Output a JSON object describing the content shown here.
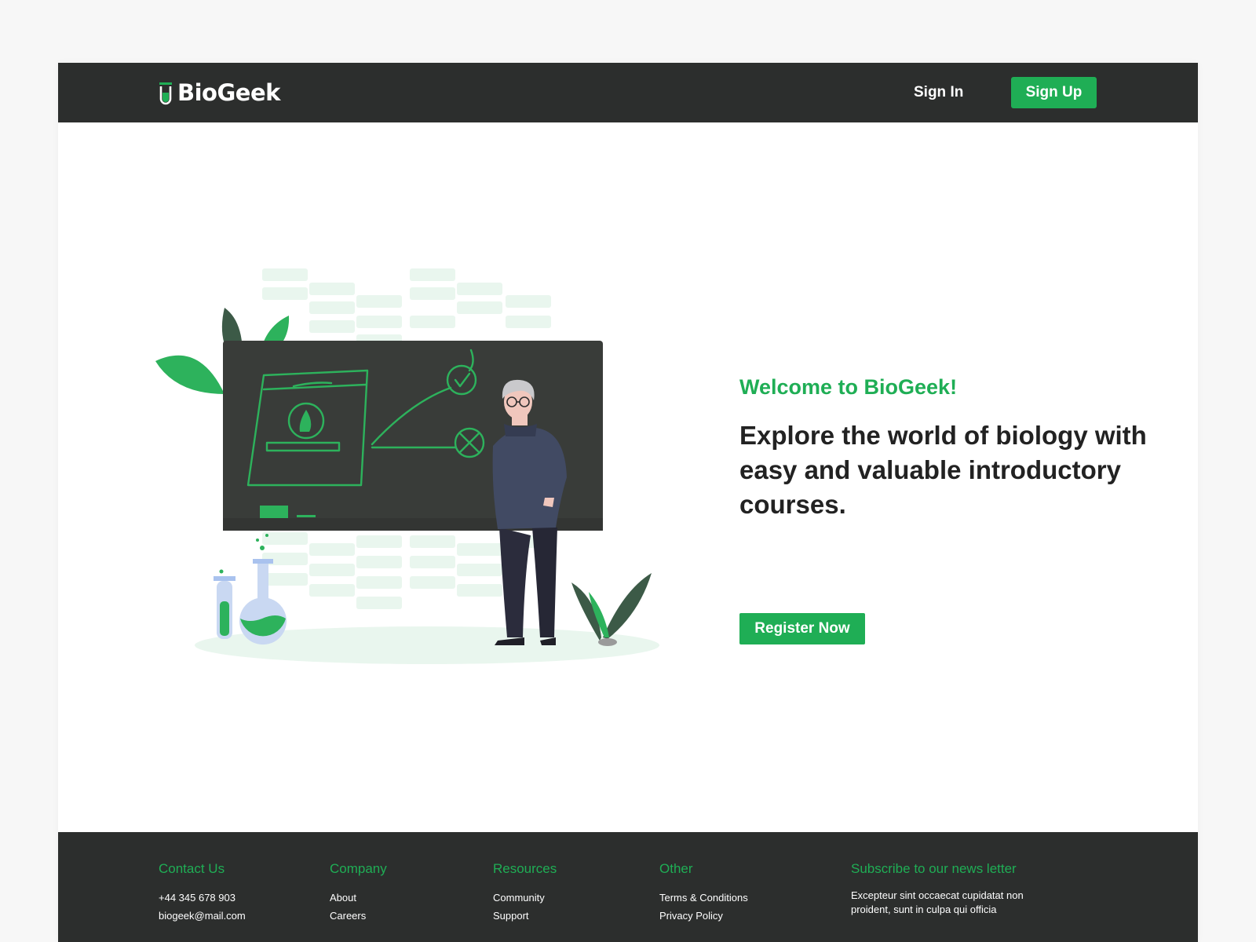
{
  "header": {
    "brand": "BioGeek",
    "signin_label": "Sign In",
    "signup_label": "Sign Up"
  },
  "hero": {
    "welcome": "Welcome to BioGeek!",
    "headline": "Explore the world of biology with easy and valuable introductory courses.",
    "cta_label": "Register Now",
    "illustration": "teacher-at-chalkboard-illustration"
  },
  "footer": {
    "contact": {
      "title": "Contact Us",
      "items": [
        "+44 345 678 903",
        "biogeek@mail.com"
      ]
    },
    "company": {
      "title": "Company",
      "items": [
        "About",
        "Careers"
      ]
    },
    "resources": {
      "title": "Resources",
      "items": [
        "Community",
        "Support"
      ]
    },
    "other": {
      "title": "Other",
      "items": [
        "Terms & Conditions",
        "Privacy Policy"
      ]
    },
    "newsletter": {
      "title": "Subscribe to our news letter",
      "text": "Excepteur sint occaecat cupidatat non proident, sunt in culpa qui officia"
    }
  },
  "colors": {
    "accent": "#1fae55",
    "dark": "#2c2e2d",
    "text": "#222222",
    "background": "#f7f7f7"
  }
}
